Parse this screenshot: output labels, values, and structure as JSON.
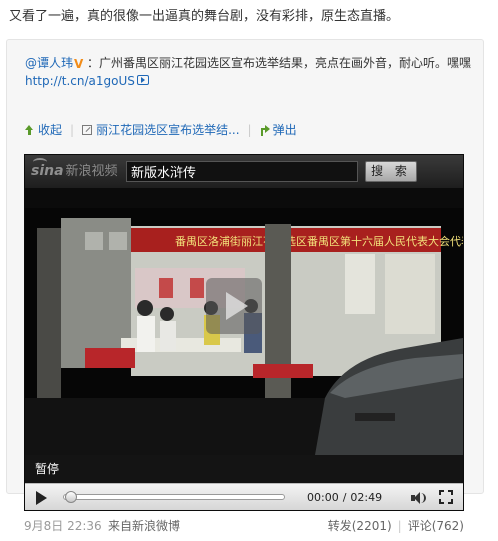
{
  "post": {
    "text": "又看了一遍，真的很像一出逼真的舞台剧，没有彩排，原生态直播。"
  },
  "quote": {
    "author": "@谭人玮",
    "colon": "：",
    "text": "广州番禺区丽江花园选区宣布选举结果，亮点在画外音，耐心听。嘿嘿",
    "link": "http://t.cn/a1goUS",
    "badge_color": "#f28c18",
    "link_color": "#1f68b7"
  },
  "actions": {
    "collapse_label": "收起",
    "title_link_label": "丽江花园选区宣布选举结...",
    "popout_label": "弹出",
    "separator": "|"
  },
  "player": {
    "brand": "新浪视频",
    "brand_mark": "sina",
    "search_value": "新版水浒传",
    "search_button": "搜 索",
    "status_label": "暂停",
    "banner_text": "番禺区洛浦街丽江花园选区番禺区第十六届人民代表大会代表选举",
    "progress_fraction": 0.0,
    "current_time": "00:00",
    "time_separator": "/",
    "duration": "02:49",
    "icons": [
      "play-icon",
      "volume-icon",
      "fullscreen-icon"
    ]
  },
  "footer": {
    "date": "9月8日 22:36",
    "source": "来自新浪微博",
    "repost_label": "转发",
    "repost_count": "(2201)",
    "comment_label": "评论",
    "comment_count": "(762)",
    "separator": "|"
  }
}
